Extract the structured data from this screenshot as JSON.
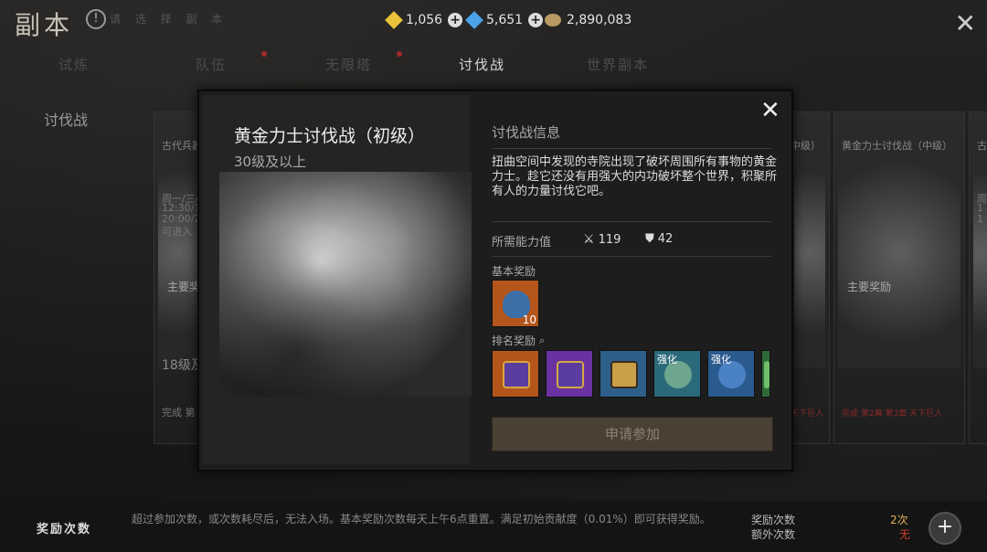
{
  "header": {
    "title": "副本",
    "subtitle": "请 选 择 副 本",
    "currencies": [
      {
        "icon": "gold-gem-icon",
        "value": "1,056",
        "color": "#e8c23a"
      },
      {
        "icon": "blue-gem-icon",
        "value": "5,651",
        "color": "#4aa3e8"
      },
      {
        "icon": "coin-pouch-icon",
        "value": "2,890,083",
        "color": "#b99a63"
      }
    ]
  },
  "tabs": [
    {
      "label": "试炼",
      "active": false
    },
    {
      "label": "队伍",
      "active": false
    },
    {
      "label": "无限塔",
      "active": false
    },
    {
      "label": "讨伐战",
      "active": true
    },
    {
      "label": "世界副本",
      "active": false
    }
  ],
  "sidebar": {
    "label": "讨伐战"
  },
  "bg_cards": {
    "left": {
      "title": "古代兵器",
      "lines": [
        "周一/三/",
        "12:30/1",
        "20:00/2",
        "可进入"
      ],
      "reward": "主要奖",
      "level": "18级及",
      "complete": "完成 第"
    },
    "right": {
      "title": "黄金力士讨伐战（中级）",
      "reward": "主要奖励",
      "red_line": "完成 第2幕 第3章 天下巨人"
    },
    "far_right": {
      "title": "古",
      "lines": [
        "周",
        "1",
        "1"
      ]
    },
    "mid_right_title": "中级）",
    "mid_right_red": "天下巨人"
  },
  "modal": {
    "title": "黄金力士讨伐战（初级）",
    "level": "30级及以上",
    "info_title": "讨伐战信息",
    "description": "扭曲空间中发现的寺院出现了破坏周围所有事物的黄金力士。趁它还没有用强大的内功破坏整个世界，积聚所有人的力量讨伐它吧。",
    "requirement_label": "所需能力值",
    "attack_value": "119",
    "defense_value": "42",
    "basic_reward_label": "基本奖励",
    "basic_reward": {
      "icon": "reward-bag-icon",
      "count": "10"
    },
    "rank_reward_label": "排名奖励",
    "rank_rewards": [
      {
        "icon": "gift-box-icon",
        "bg": "#b4561c",
        "tag": ""
      },
      {
        "icon": "gift-box-purple-icon",
        "bg": "#6a32a0",
        "tag": ""
      },
      {
        "icon": "treasure-chest-icon",
        "bg": "#2d5f8a",
        "tag": ""
      },
      {
        "icon": "green-stone-icon",
        "bg": "#2b6a7a",
        "tag": "强化"
      },
      {
        "icon": "blue-stone-icon",
        "bg": "#2b5a8e",
        "tag": "强化"
      },
      {
        "icon": "partial-item-icon",
        "bg": "#2e6a3a",
        "tag": ""
      }
    ],
    "join_button": "申请参加"
  },
  "footer": {
    "label": "奖励次数",
    "text": "超过参加次数，或次数耗尽后，无法入场。基本奖励次数每天上午6点重置。满足初始贡献度（0.01%）即可获得奖励。",
    "reward_count_label": "奖励次数",
    "extra_count_label": "额外次数",
    "reward_count_value": "2次",
    "extra_count_value": "无"
  }
}
